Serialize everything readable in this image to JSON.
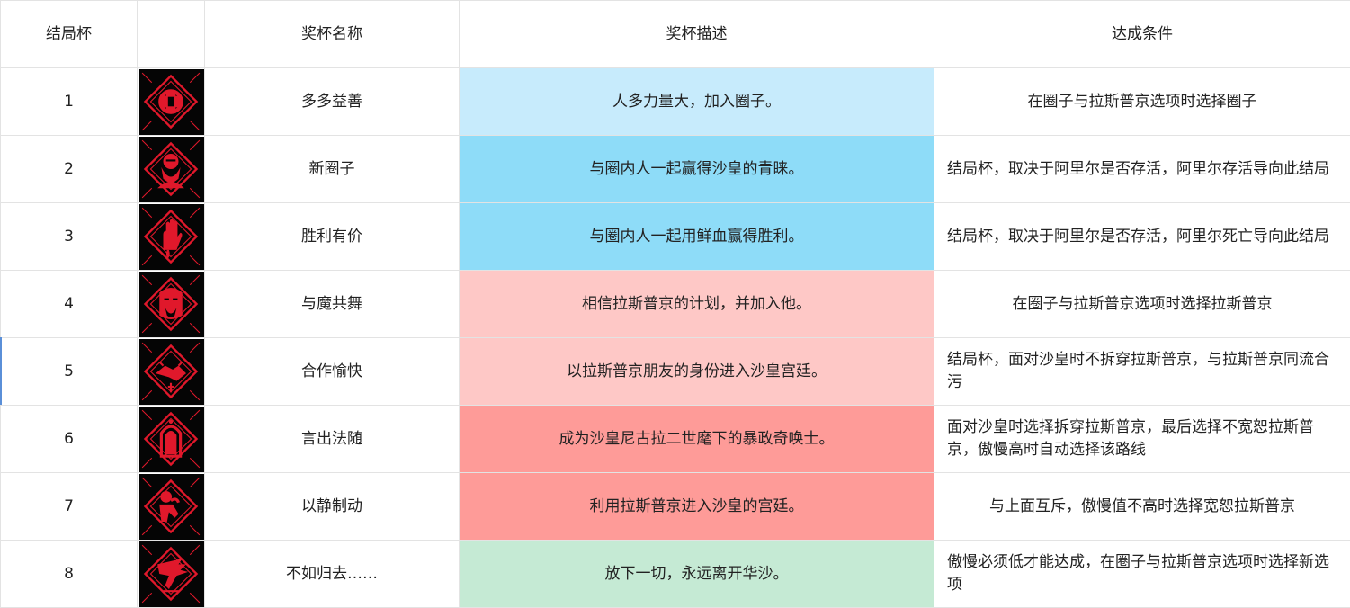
{
  "headers": [
    "结局杯",
    "",
    "奖杯名称",
    "奖杯描述",
    "达成条件"
  ],
  "rows": [
    {
      "num": "1",
      "icon": "circle-unity-icon",
      "name": "多多益善",
      "desc": "人多力量大，加入圈子。",
      "cond": "在圈子与拉斯普京选项时选择圈子",
      "color": "#c7ebfc"
    },
    {
      "num": "2",
      "icon": "bearded-man-icon",
      "name": "新圈子",
      "desc": "与圈内人一起赢得沙皇的青睐。",
      "cond": "结局杯，取决于阿里尔是否存活，阿里尔存活导向此结局",
      "color": "#8edcf8"
    },
    {
      "num": "3",
      "icon": "bloody-hand-icon",
      "name": "胜利有价",
      "desc": "与圈内人一起用鲜血赢得胜利。",
      "cond": "结局杯，取决于阿里尔是否存活，阿里尔死亡导向此结局",
      "color": "#8edcf8"
    },
    {
      "num": "4",
      "icon": "rasputin-face-icon",
      "name": "与魔共舞",
      "desc": "相信拉斯普京的计划，并加入他。",
      "cond": "在圈子与拉斯普京选项时选择拉斯普京",
      "color": "#fec8c6"
    },
    {
      "num": "5",
      "icon": "handshake-icon",
      "name": "合作愉快",
      "desc": "以拉斯普京朋友的身份进入沙皇宫廷。",
      "cond": "结局杯，面对沙皇时不拆穿拉斯普京，与拉斯普京同流合污",
      "color": "#fec8c6"
    },
    {
      "num": "6",
      "icon": "palace-door-icon",
      "name": "言出法随",
      "desc": "成为沙皇尼古拉二世麾下的暴政奇唤士。",
      "cond": "面对沙皇时选择拆穿拉斯普京，最后选择不宽恕拉斯普京，傲慢高时自动选择该路线",
      "color": "#fe9b98"
    },
    {
      "num": "7",
      "icon": "thinker-icon",
      "name": "以静制动",
      "desc": "利用拉斯普京进入沙皇的宫廷。",
      "cond": "与上面互斥，傲慢值不高时选择宽恕拉斯普京",
      "color": "#fe9b98"
    },
    {
      "num": "8",
      "icon": "departing-wing-icon",
      "name": "不如归去……",
      "desc": "放下一切，永远离开华沙。",
      "cond": "傲慢必须低才能达成，在圈子与拉斯普京选项时选择新选项",
      "color": "#c5ead4"
    }
  ]
}
